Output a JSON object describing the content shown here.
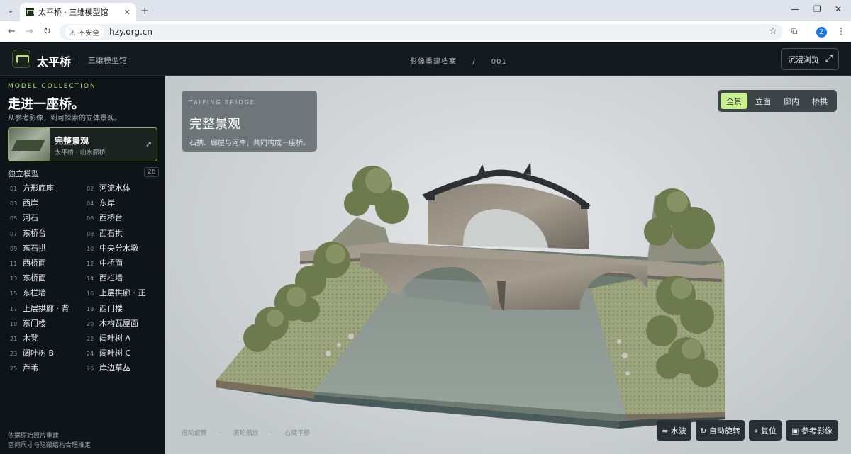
{
  "browser": {
    "tab_title": "太平桥 · 三维模型馆",
    "security_label": "不安全",
    "url": "hzy.org.cn",
    "profile_initial": "Z"
  },
  "header": {
    "brand": "太平桥",
    "subbrand": "三维模型馆",
    "crumb_1": "影像重建档案",
    "crumb_sep": "/",
    "crumb_2": "001",
    "immersive_label": "沉浸浏览"
  },
  "sidebar": {
    "collection_label": "MODEL COLLECTION",
    "title": "走进一座桥。",
    "subtitle": "从参考影像，到可探索的立体景观。",
    "featured": {
      "title": "完整景观",
      "subtitle": "太平桥 · 山水廊桥"
    },
    "section_label": "独立模型",
    "count": "26",
    "models": [
      {
        "num": "01",
        "name": "方形底座"
      },
      {
        "num": "02",
        "name": "河流水体"
      },
      {
        "num": "03",
        "name": "西岸"
      },
      {
        "num": "04",
        "name": "东岸"
      },
      {
        "num": "05",
        "name": "河石"
      },
      {
        "num": "06",
        "name": "西桥台"
      },
      {
        "num": "07",
        "name": "东桥台"
      },
      {
        "num": "08",
        "name": "西石拱"
      },
      {
        "num": "09",
        "name": "东石拱"
      },
      {
        "num": "10",
        "name": "中央分水墩"
      },
      {
        "num": "11",
        "name": "西桥面"
      },
      {
        "num": "12",
        "name": "中桥面"
      },
      {
        "num": "13",
        "name": "东桥面"
      },
      {
        "num": "14",
        "name": "西栏墙"
      },
      {
        "num": "15",
        "name": "东栏墙"
      },
      {
        "num": "16",
        "name": "上层拱廊 · 正"
      },
      {
        "num": "17",
        "name": "上层拱廊 · 背"
      },
      {
        "num": "18",
        "name": "西门楼"
      },
      {
        "num": "19",
        "name": "东门楼"
      },
      {
        "num": "20",
        "name": "木构瓦屋面"
      },
      {
        "num": "21",
        "name": "木凳"
      },
      {
        "num": "22",
        "name": "阔叶树 A"
      },
      {
        "num": "23",
        "name": "阔叶树 B"
      },
      {
        "num": "24",
        "name": "阔叶树 C"
      },
      {
        "num": "25",
        "name": "芦苇"
      },
      {
        "num": "26",
        "name": "岸边草丛"
      }
    ],
    "footer_1": "依据原始照片重建",
    "footer_2": "空间尺寸与隐蔽结构合理推定"
  },
  "viewer": {
    "eyebrow": "TAIPING BRIDGE",
    "title": "完整景观",
    "description": "石拱、廊屋与河岸，共同构成一座桥。",
    "views": [
      "全景",
      "立面",
      "廊内",
      "桥拱"
    ],
    "active_view": "全景",
    "hints": [
      "拖动旋转",
      "滚轮缩放",
      "右键平移"
    ],
    "controls": {
      "water": "≈ 水波",
      "rotate": "↻ 自动旋转",
      "reset": "⌖ 复位",
      "reference": "▣ 参考影像"
    }
  },
  "colors": {
    "accent": "#b6e07a",
    "active_view_bg": "#c8ef90",
    "panel": "#0f1418"
  }
}
